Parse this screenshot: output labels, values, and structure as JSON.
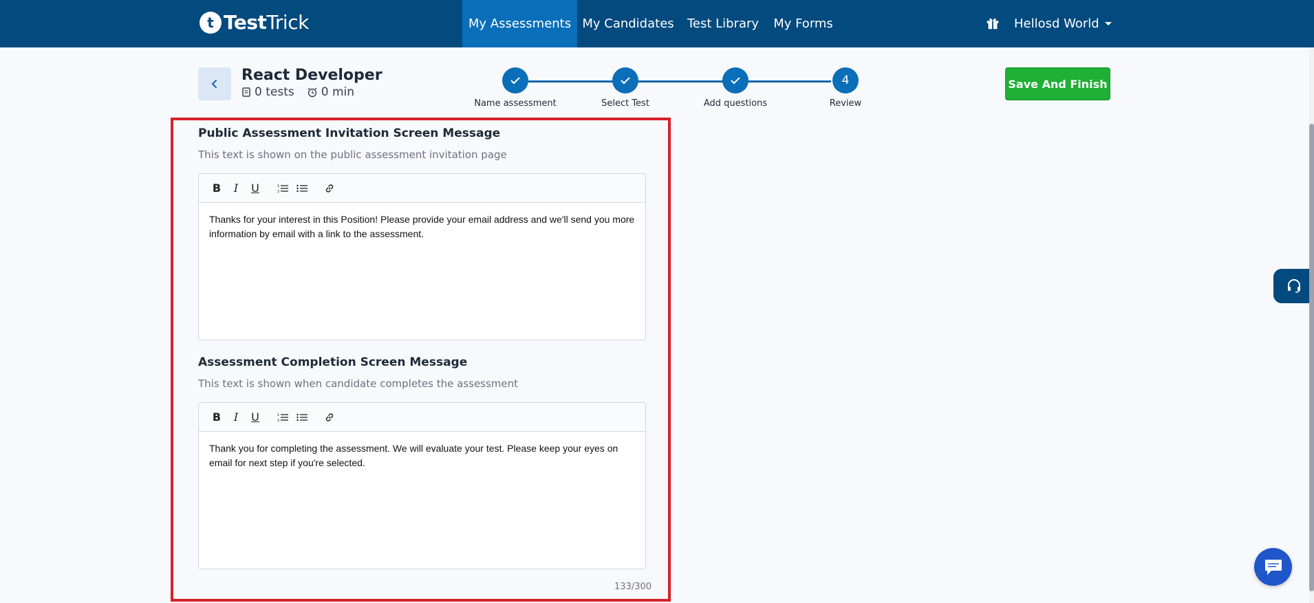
{
  "brand": {
    "badge": "t",
    "name_bold": "Test",
    "name_light": "Trick"
  },
  "nav": {
    "items": [
      {
        "label": "My Assessments",
        "active": true
      },
      {
        "label": "My Candidates",
        "active": false
      },
      {
        "label": "Test Library",
        "active": false
      },
      {
        "label": "My Forms",
        "active": false
      }
    ],
    "user": "Hellosd World"
  },
  "assessment": {
    "title": "React Developer",
    "tests": "0 tests",
    "duration": "0 min"
  },
  "stepper": {
    "steps": [
      {
        "label": "Name assessment",
        "state": "done",
        "number": ""
      },
      {
        "label": "Select Test",
        "state": "done",
        "number": ""
      },
      {
        "label": "Add questions",
        "state": "done",
        "number": ""
      },
      {
        "label": "Review",
        "state": "current",
        "number": "4"
      }
    ]
  },
  "actions": {
    "save_finish": "Save And Finish"
  },
  "sections": {
    "invitation": {
      "title": "Public Assessment Invitation Screen Message",
      "subtitle": "This text is shown on the public assessment invitation page",
      "content": "Thanks for your interest in this Position! Please provide your email address and we'll send you more information by email with a link to the assessment."
    },
    "completion": {
      "title": "Assessment Completion Screen Message",
      "subtitle": "This text is shown when candidate completes the assessment",
      "content": "Thank you for completing the assessment. We will evaluate your test. Please keep your eyes on email for next step if you're selected."
    }
  },
  "toolbar": {
    "bold": "B",
    "italic": "I",
    "underline": "U"
  },
  "counter": "133/300",
  "colors": {
    "nav": "#034a7e",
    "nav_active": "#0a6fb8",
    "save": "#1fb035",
    "highlight": "#d7212b"
  }
}
